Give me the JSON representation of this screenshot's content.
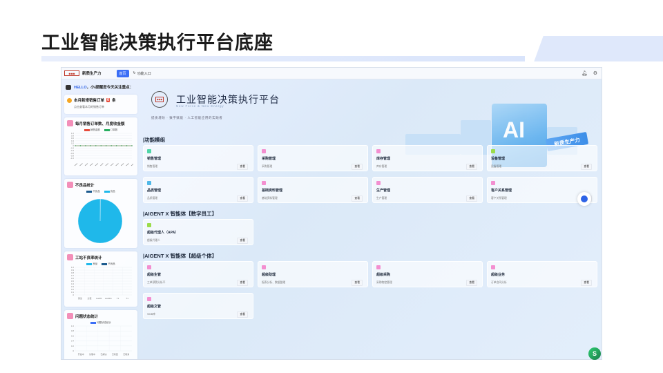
{
  "slide": {
    "title": "工业智能决策执行平台底座"
  },
  "topbar": {
    "logo_text": "",
    "brand": "新质生产力",
    "home_tab": "首页",
    "tab2": "功能入口"
  },
  "sidebar": {
    "greeting_prefix": "HELLO",
    "greeting_text": "，小i提醒您今天关注重点：",
    "orders_card": {
      "title_prefix": "本月新增销售订单",
      "count": "0",
      "title_suffix": "条",
      "subtitle": "点击查看本月的销售订单"
    },
    "monthly_card": {
      "title": "每月销售订单数、月度收金额",
      "legend": [
        "销售金额",
        "订单数"
      ]
    },
    "defect_card": {
      "title": "不良品统计",
      "legend": [
        "不良品",
        "良品"
      ]
    },
    "station_card": {
      "title": "工站不良率统计",
      "legend": [
        "良品",
        "不良品"
      ]
    },
    "issue_card": {
      "title": "问题状态统计",
      "legend": [
        "问题状态统计"
      ]
    }
  },
  "hero": {
    "title": "工业智能决策执行平台",
    "subtitle": "New Force & New Energy",
    "slogan": "提质增效 · 数字赋能 · 人工智能应用的实践者",
    "ai_text": "AI",
    "ai_tag": "新质生产力"
  },
  "sections": {
    "modules": "|功能模组",
    "digital": "|AIGENT X 智能体【数字员工】",
    "super": "|AIGENT X 智能体【超级个体】"
  },
  "modules": [
    {
      "name": "销售管理",
      "desc": "销售管理",
      "btn": "查看",
      "color": "#4fd6a8"
    },
    {
      "name": "采购管理",
      "desc": "采购管理",
      "btn": "查看",
      "color": "#f38fd0"
    },
    {
      "name": "库存管理",
      "desc": "库存管理",
      "btn": "查看",
      "color": "#f38fd0"
    },
    {
      "name": "设备管理",
      "desc": "设备管理",
      "btn": "查看",
      "color": "#9bdc4a"
    },
    {
      "name": "品质管理",
      "desc": "品质管理",
      "btn": "查看",
      "color": "#4fb8e8"
    },
    {
      "name": "基础资料管理",
      "desc": "基础资料管理",
      "btn": "查看",
      "color": "#f38fd0"
    },
    {
      "name": "生产管理",
      "desc": "生产管理",
      "btn": "查看",
      "color": "#f38fd0"
    },
    {
      "name": "客户关系管理",
      "desc": "客户关系管理",
      "btn": "查看",
      "color": "#f38fd0"
    }
  ],
  "digital_agents": [
    {
      "name": "超级代理人（APA）",
      "desc": "超级代理人",
      "btn": "查看",
      "color": "#9bdc4a"
    }
  ],
  "super_agents": [
    {
      "name": "超级生管",
      "desc": "工单预警分析平",
      "btn": "查看",
      "color": "#f38fd0"
    },
    {
      "name": "超级助理",
      "desc": "报表分析、数据整理",
      "btn": "查看",
      "color": "#f38fd0"
    },
    {
      "name": "超级采购",
      "desc": "采购物控管理",
      "btn": "查看",
      "color": "#f38fd0"
    },
    {
      "name": "超级业务",
      "desc": "订单合同分析",
      "btn": "查看",
      "color": "#f38fd0"
    },
    {
      "name": "超级文管",
      "desc": "SMB库",
      "btn": "查看",
      "color": "#f38fd0"
    }
  ],
  "colors": {
    "accent": "#3b6ef6",
    "pie": "#1fb8ea",
    "pink": "#f38fb9"
  },
  "chart_data": [
    {
      "type": "line",
      "title": "每月销售订单数、月度收金额",
      "series": [
        {
          "name": "销售金额",
          "values": [
            0,
            0,
            0,
            0,
            0,
            0,
            0,
            0,
            0,
            0,
            0,
            0
          ]
        },
        {
          "name": "订单数",
          "values": [
            0,
            0,
            0,
            0,
            0,
            0,
            0,
            0,
            0,
            0,
            0,
            0
          ]
        }
      ],
      "y_ticks": [
        "1.0",
        "0.8",
        "0.6",
        "0.4",
        "0.2",
        "0",
        "-0.2",
        "-0.4",
        "-0.6",
        "-0.8",
        "-1.0"
      ],
      "ylim": [
        -1,
        1
      ]
    },
    {
      "type": "pie",
      "title": "不良品统计",
      "categories": [
        "不良品",
        "良品"
      ],
      "values": [
        0.2,
        99.8
      ]
    },
    {
      "type": "bar",
      "title": "工站不良率统计",
      "categories": [
        "测试",
        "分装",
        "test05",
        "test001",
        "T1",
        "T1"
      ],
      "series": [
        {
          "name": "良品",
          "values": [
            0,
            0,
            0,
            0,
            0,
            0
          ]
        },
        {
          "name": "不良品",
          "values": [
            0,
            0,
            0,
            0,
            0,
            0
          ]
        }
      ],
      "y_ticks": [
        "1.0",
        "0.9",
        "0.8",
        "0.7",
        "0.6",
        "0.5",
        "0.4",
        "0.3",
        "0.2",
        "0.1",
        "0"
      ],
      "ylim": [
        0,
        1
      ]
    },
    {
      "type": "bar",
      "title": "问题状态统计",
      "categories": [
        "开始中",
        "处理中",
        "已解决",
        "已驳回",
        "已取消"
      ],
      "series": [
        {
          "name": "问题状态统计",
          "values": [
            0,
            0,
            0,
            0,
            0
          ]
        }
      ],
      "y_ticks": [
        "1.0",
        "0.8",
        "0.6",
        "0.4",
        "0.2",
        "0"
      ],
      "ylim": [
        0,
        1
      ]
    }
  ]
}
